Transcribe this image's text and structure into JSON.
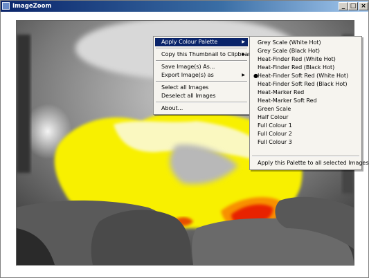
{
  "window": {
    "title": "ImageZoom"
  },
  "caption_buttons": {
    "minimize": "_",
    "maximize": "□",
    "close": "×"
  },
  "context_menu": {
    "items": [
      {
        "label": "Apply Colour Palette",
        "submenu": true,
        "highlighted": true
      },
      {
        "label": "Copy this Thumbnail to Clipboard",
        "submenu": true
      },
      {
        "label": "Save Image(s) As..."
      },
      {
        "label": "Export Image(s) as",
        "submenu": true
      },
      {
        "label": "Select all Images"
      },
      {
        "label": "Deselect all Images"
      },
      {
        "label": "About..."
      }
    ]
  },
  "palette_submenu": {
    "items": [
      {
        "label": "Grey Scale (White Hot)"
      },
      {
        "label": "Grey Scale (Black Hot)"
      },
      {
        "label": "Heat-Finder Red (White Hot)"
      },
      {
        "label": "Heat-Finder Red (Black Hot)"
      },
      {
        "label": "Heat-Finder Soft Red (White Hot)",
        "checked": true
      },
      {
        "label": "Heat-Finder Soft Red (Black Hot)"
      },
      {
        "label": "Heat-Marker Red"
      },
      {
        "label": "Heat-Marker Soft Red"
      },
      {
        "label": "Green Scale"
      },
      {
        "label": "Half Colour"
      },
      {
        "label": "Full Colour 1"
      },
      {
        "label": "Full Colour 2"
      },
      {
        "label": "Full Colour 3"
      }
    ],
    "apply_all": "Apply this Palette to all selected Images"
  },
  "colors": {
    "menu_highlight": "#0a246a",
    "heat_yellow": "#f8f000",
    "heat_red": "#e82000"
  }
}
